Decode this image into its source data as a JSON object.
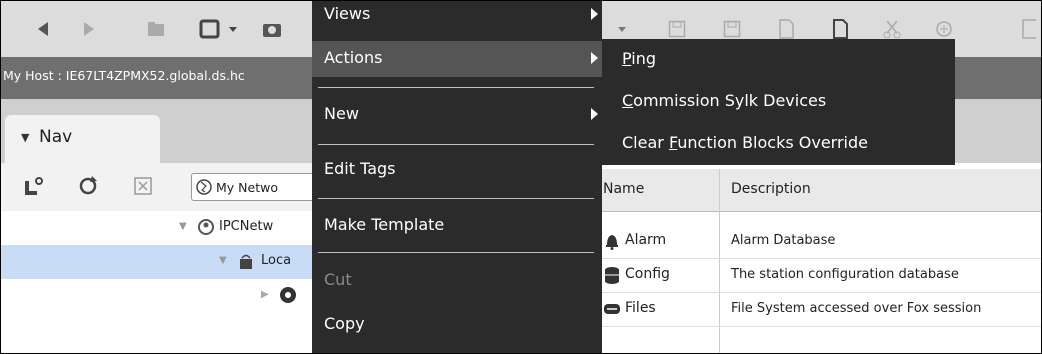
{
  "host_bar": {
    "host": "My Host : IE67LT4ZPMX52.global.ds.hc"
  },
  "nav": {
    "tab_label": "Nav",
    "network_selector": "My Netwo",
    "tree": [
      {
        "label": "IPCNetw"
      },
      {
        "label": "Loca"
      },
      {
        "label": ""
      }
    ]
  },
  "table": {
    "headers": {
      "name": "Name",
      "description": "Description"
    },
    "rows": [
      {
        "name": "Alarm",
        "description": "Alarm Database",
        "icon": "bell-icon"
      },
      {
        "name": "Config",
        "description": "The station configuration database",
        "icon": "database-icon"
      },
      {
        "name": "Files",
        "description": "File System accessed over Fox session",
        "icon": "drive-icon"
      }
    ]
  },
  "context_menu": {
    "items": [
      {
        "label": "Views",
        "submenu": true,
        "disabled": false
      },
      {
        "label": "Actions",
        "submenu": true,
        "disabled": false,
        "highlighted": true
      },
      {
        "label": "New",
        "submenu": true,
        "disabled": false
      },
      {
        "label": "Edit Tags",
        "submenu": false,
        "disabled": false
      },
      {
        "label": "Make Template",
        "submenu": false,
        "disabled": false
      },
      {
        "label": "Cut",
        "submenu": false,
        "disabled": true
      },
      {
        "label": "Copy",
        "submenu": false,
        "disabled": false
      }
    ]
  },
  "actions_submenu": {
    "items": [
      {
        "before": "",
        "mnemonic": "P",
        "after": "ing"
      },
      {
        "before": "",
        "mnemonic": "C",
        "after": "ommission Sylk Devices"
      },
      {
        "before": "Clear ",
        "mnemonic": "F",
        "after": "unction Blocks Override"
      }
    ]
  },
  "colors": {
    "menu_bg": "#2b2b2b",
    "menu_highlight": "#555555",
    "selection": "#c9dcf5",
    "host_bar": "#6f6f6f"
  }
}
